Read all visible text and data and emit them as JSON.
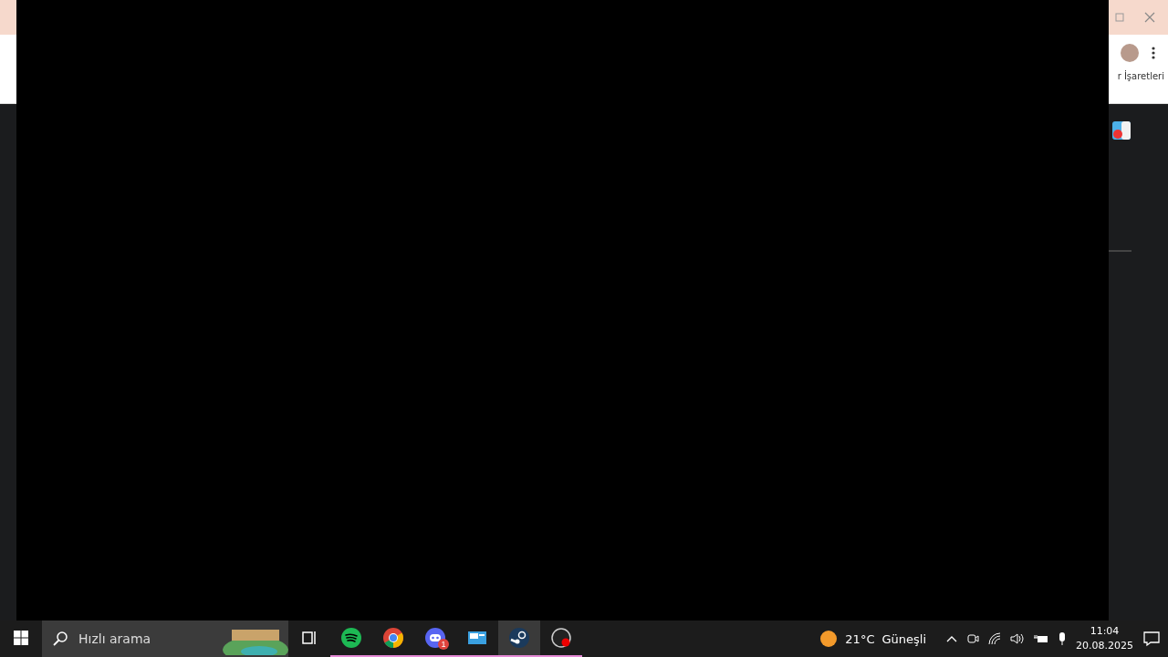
{
  "browser": {
    "bookmarks_text": "r İşaretleri"
  },
  "taskbar": {
    "search": {
      "placeholder": "Hızlı arama"
    },
    "apps": [
      {
        "kind": "taskview",
        "running": false,
        "active": false
      },
      {
        "kind": "spotify",
        "running": true,
        "active": false
      },
      {
        "kind": "chrome",
        "running": true,
        "active": false
      },
      {
        "kind": "discord",
        "running": true,
        "active": false,
        "badge": "1"
      },
      {
        "kind": "monitor",
        "running": true,
        "active": false
      },
      {
        "kind": "steam",
        "running": true,
        "active": true
      },
      {
        "kind": "obs",
        "running": true,
        "active": false
      }
    ],
    "weather": {
      "temperature": "21°C",
      "condition": "Güneşli"
    },
    "clock": {
      "time": "11:04",
      "date": "20.08.2025"
    }
  }
}
